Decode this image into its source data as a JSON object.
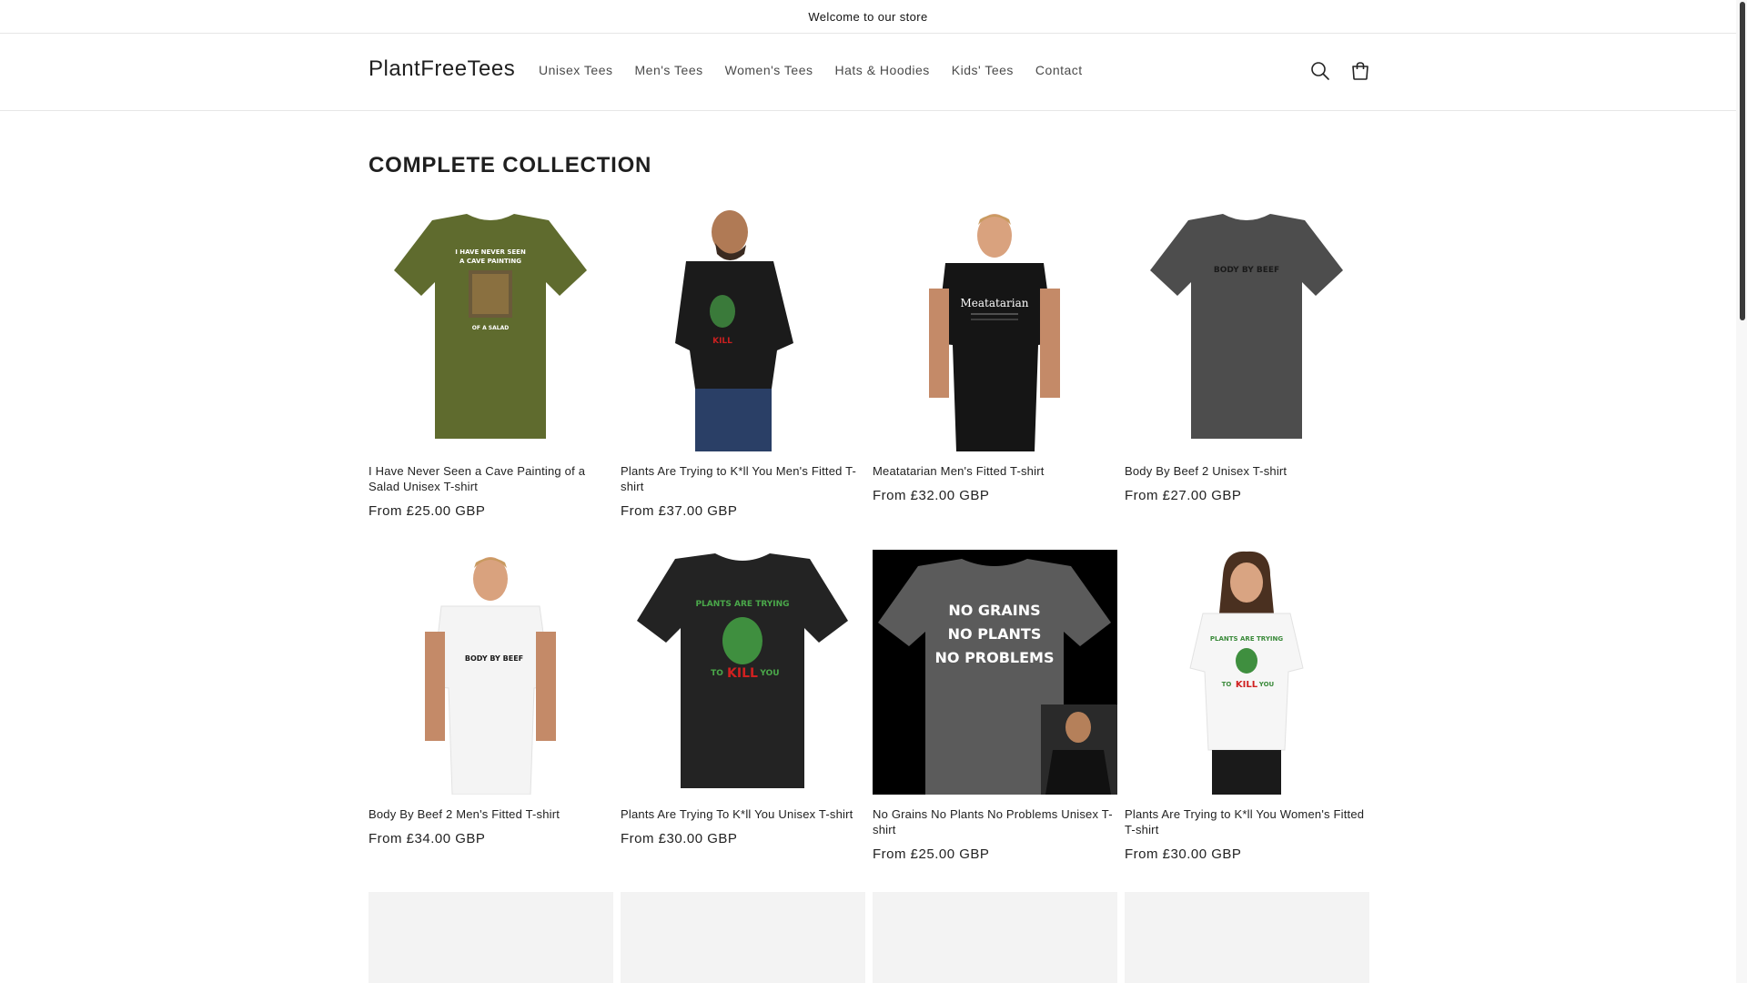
{
  "announcement": {
    "text": "Welcome to our store"
  },
  "header": {
    "logo": "PlantFreeTees",
    "nav": [
      "Unisex Tees",
      "Men's Tees",
      "Women's Tees",
      "Hats & Hoodies",
      "Kids' Tees",
      "Contact"
    ],
    "icons": {
      "search": "search-icon",
      "cart": "cart-icon"
    }
  },
  "collection": {
    "title": "COMPLETE COLLECTION",
    "products": [
      {
        "title": "I Have Never Seen a Cave Painting of a Salad Unisex T-shirt",
        "price": "From £25.00 GBP",
        "shirt_color": "#5f6b2e",
        "print": [
          "I HAVE NEVER SEEN",
          "A CAVE PAINTING",
          "OF A SALAD"
        ]
      },
      {
        "title": "Plants Are Trying to K*ll You Men's Fitted T-shirt",
        "price": "From £37.00 GBP",
        "shirt_color": "#1b1b1b"
      },
      {
        "title": "Meatatarian Men's Fitted T-shirt",
        "price": "From £32.00 GBP",
        "shirt_color": "#151515",
        "print": [
          "Meatatarian"
        ]
      },
      {
        "title": "Body By Beef 2 Unisex T-shirt",
        "price": "From £27.00 GBP",
        "shirt_color": "#4d4d4d",
        "print": [
          "BODY BY BEEF"
        ]
      },
      {
        "title": "Body By Beef 2 Men's Fitted T-shirt",
        "price": "From £34.00 GBP",
        "shirt_color": "#f4f4f4",
        "print": [
          "BODY BY BEEF"
        ]
      },
      {
        "title": "Plants Are Trying To K*ll You Unisex T-shirt",
        "price": "From £30.00 GBP",
        "shirt_color": "#232323",
        "print": [
          "PLANTS ARE TRYING",
          "TO",
          "KILL",
          "YOU"
        ]
      },
      {
        "title": "No Grains No Plants No Problems Unisex T-shirt",
        "price": "From £25.00 GBP",
        "shirt_color": "#5b5b5b",
        "print": [
          "NO GRAINS",
          "NO PLANTS",
          "NO PROBLEMS"
        ]
      },
      {
        "title": "Plants Are Trying to K*ll You Women's Fitted T-shirt",
        "price": "From £30.00 GBP",
        "shirt_color": "#f6f6f6",
        "print": [
          "PLANTS ARE TRYING",
          "TO",
          "KILL",
          "YOU"
        ]
      }
    ]
  }
}
